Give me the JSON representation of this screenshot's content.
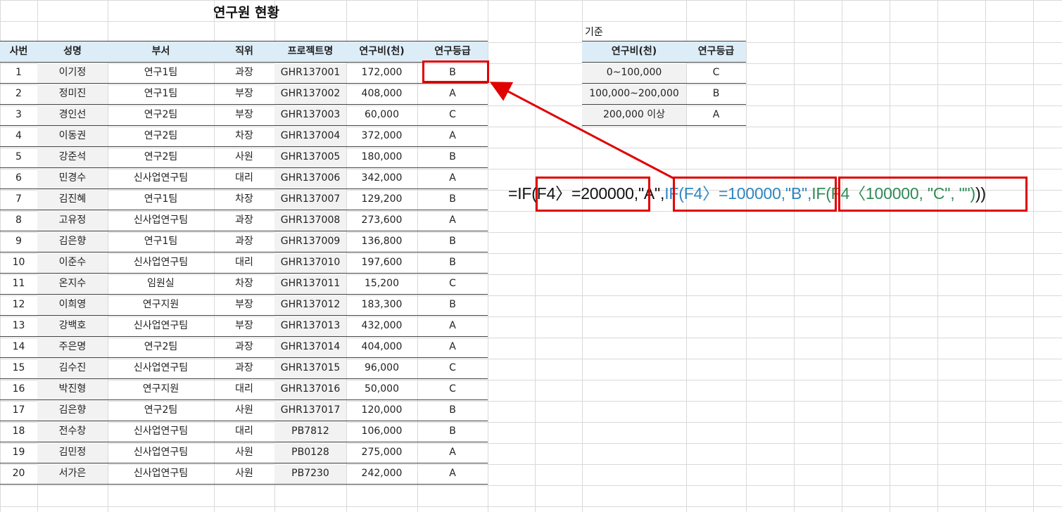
{
  "title": "연구원 현황",
  "table": {
    "headers": [
      "사번",
      "성명",
      "부서",
      "직위",
      "프로젝트명",
      "연구비(천)",
      "연구등급"
    ],
    "rows": [
      [
        "1",
        "이기정",
        "연구1팀",
        "과장",
        "GHR137001",
        "172,000",
        "B"
      ],
      [
        "2",
        "정미진",
        "연구1팀",
        "부장",
        "GHR137002",
        "408,000",
        "A"
      ],
      [
        "3",
        "경인선",
        "연구2팀",
        "부장",
        "GHR137003",
        "60,000",
        "C"
      ],
      [
        "4",
        "이동권",
        "연구2팀",
        "차장",
        "GHR137004",
        "372,000",
        "A"
      ],
      [
        "5",
        "강준석",
        "연구2팀",
        "사원",
        "GHR137005",
        "180,000",
        "B"
      ],
      [
        "6",
        "민경수",
        "신사업연구팀",
        "대리",
        "GHR137006",
        "342,000",
        "A"
      ],
      [
        "7",
        "김진혜",
        "연구1팀",
        "차장",
        "GHR137007",
        "129,200",
        "B"
      ],
      [
        "8",
        "고유정",
        "신사업연구팀",
        "과장",
        "GHR137008",
        "273,600",
        "A"
      ],
      [
        "9",
        "김은향",
        "연구1팀",
        "과장",
        "GHR137009",
        "136,800",
        "B"
      ],
      [
        "10",
        "이준수",
        "신사업연구팀",
        "대리",
        "GHR137010",
        "197,600",
        "B"
      ],
      [
        "11",
        "온지수",
        "임원실",
        "차장",
        "GHR137011",
        "15,200",
        "C"
      ],
      [
        "12",
        "이희영",
        "연구지원",
        "부장",
        "GHR137012",
        "183,300",
        "B"
      ],
      [
        "13",
        "강백호",
        "신사업연구팀",
        "부장",
        "GHR137013",
        "432,000",
        "A"
      ],
      [
        "14",
        "주은명",
        "연구2팀",
        "과장",
        "GHR137014",
        "404,000",
        "A"
      ],
      [
        "15",
        "김수진",
        "신사업연구팀",
        "과장",
        "GHR137015",
        "96,000",
        "C"
      ],
      [
        "16",
        "박진형",
        "연구지원",
        "대리",
        "GHR137016",
        "50,000",
        "C"
      ],
      [
        "17",
        "김은향",
        "연구2팀",
        "사원",
        "GHR137017",
        "120,000",
        "B"
      ],
      [
        "18",
        "전수창",
        "신사업연구팀",
        "대리",
        "PB7812",
        "106,000",
        "B"
      ],
      [
        "19",
        "김민정",
        "신사업연구팀",
        "사원",
        "PB0128",
        "275,000",
        "A"
      ],
      [
        "20",
        "서가은",
        "신사업연구팀",
        "사원",
        "PB7230",
        "242,000",
        "A"
      ]
    ]
  },
  "criteria": {
    "label": "기준",
    "headers": [
      "연구비(천)",
      "연구등급"
    ],
    "rows": [
      [
        "0~100,000",
        "C"
      ],
      [
        "100,000~200,000",
        "B"
      ],
      [
        "200,000 이상",
        "A"
      ]
    ]
  },
  "formula": {
    "part1": "=IF(F4〉=200000,\"A\",",
    "part2": "IF(F4〉=100000,\"B\",",
    "part3": "IF(F4〈100000, \"C\", \"\")",
    "closing": "))"
  },
  "colors": {
    "header_bg": "#dcedf8",
    "highlight": "#e00000",
    "formula_blue": "#2e86c1",
    "formula_green": "#2e8b57"
  }
}
